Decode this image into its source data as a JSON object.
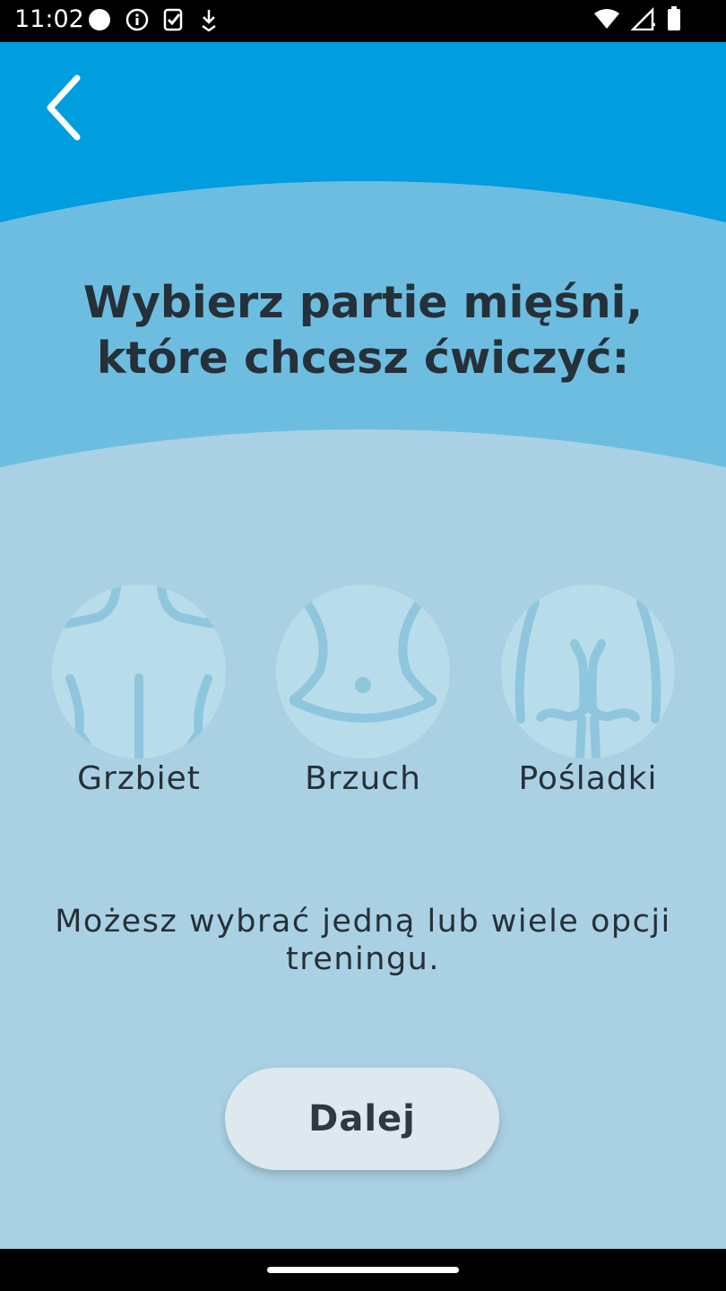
{
  "status_bar": {
    "time": "11:02",
    "left_icons": [
      "circle-notification-icon",
      "info-icon",
      "clipboard-check-icon",
      "download-icon"
    ],
    "right_icons": [
      "wifi-icon",
      "signal-icon",
      "battery-icon"
    ]
  },
  "header": {
    "back_icon": "chevron-left-icon",
    "title_line1": "Wybierz partie mięśni,",
    "title_line2": "które chcesz ćwiczyć:"
  },
  "options": [
    {
      "label": "Grzbiet",
      "icon": "back-muscles-icon"
    },
    {
      "label": "Brzuch",
      "icon": "abdomen-icon"
    },
    {
      "label": "Pośladki",
      "icon": "glutes-icon"
    }
  ],
  "hint": "Możesz wybrać jedną lub wiele opcji treningu.",
  "next_button": {
    "label": "Dalej"
  },
  "colors": {
    "header_blue": "#009ddf",
    "mid_blue": "#6dbde1",
    "light_blue": "#a9d1e3",
    "icon_circle": "#b8dcea",
    "icon_stroke": "#8ec6de",
    "text_dark": "#263038",
    "button_bg": "#dde9ef"
  }
}
